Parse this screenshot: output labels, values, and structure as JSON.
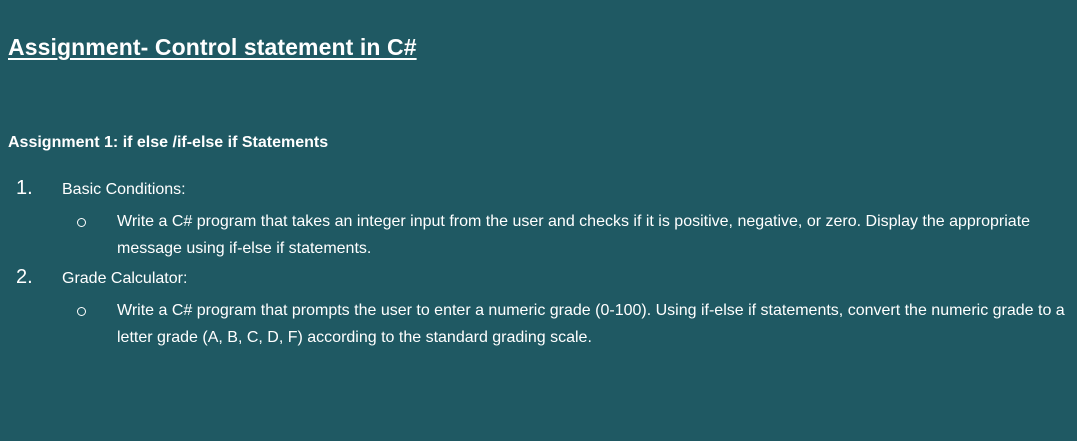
{
  "document": {
    "title": "Assignment- Control statement in C#",
    "section_heading": "Assignment 1: if else /if-else if Statements",
    "tasks": [
      {
        "number": "1.",
        "title": "Basic Conditions:",
        "detail": "Write a C# program that takes an integer input from the user and checks if it is positive, negative, or zero. Display the appropriate message using if-else if statements."
      },
      {
        "number": "2.",
        "title": "Grade Calculator:",
        "detail": "Write a C# program  that prompts the user to enter a numeric grade (0-100). Using if-else if statements, convert the numeric grade to a letter grade (A, B, C, D, F) according to the standard grading scale."
      }
    ]
  },
  "colors": {
    "background": "#1f5963",
    "text": "#ffffff"
  }
}
